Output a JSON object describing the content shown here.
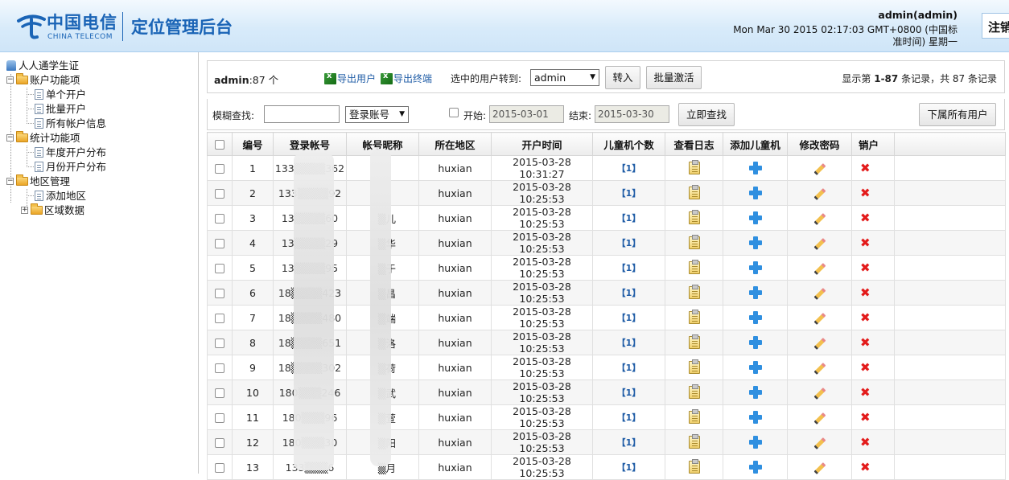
{
  "header": {
    "logo_cn": "中国电信",
    "logo_en": "CHINA TELECOM",
    "app_title": "定位管理后台",
    "user": "admin(admin)",
    "datetime": "Mon Mar 30 2015 02:17:03 GMT+0800 (中国标准时间) 星期一",
    "logout_label": "注销",
    "brand_color": "#1a64b6"
  },
  "sidebar": {
    "root": "人人通学生证",
    "groups": [
      {
        "label": "账户功能项",
        "items": [
          "单个开户",
          "批量开户",
          "所有帐户信息"
        ]
      },
      {
        "label": "统计功能项",
        "items": [
          "年度开户分布",
          "月份开户分布"
        ]
      },
      {
        "label": "地区管理",
        "items": [
          "添加地区",
          "区域数据"
        ]
      }
    ]
  },
  "toolbar": {
    "admin_label": "admin",
    "admin_count": ":87 个",
    "export_users": "导出用户",
    "export_terminals": "导出终端",
    "transfer_label": "选中的用户转到:",
    "transfer_select": "admin",
    "transfer_button": "转入",
    "batch_activate": "批量激活",
    "records_prefix": "显示第 ",
    "records_range": "1-87",
    "records_mid": " 条记录，共 ",
    "records_total": "87",
    "records_suffix": " 条记录"
  },
  "search": {
    "fuzzy_label": "模糊查找:",
    "fuzzy_value": "",
    "field_select": "登录账号",
    "start_label": "开始:",
    "start_date": "2015-03-01",
    "end_label": "结束:",
    "end_date": "2015-03-30",
    "search_button": "立即查找",
    "sub_users_button": "下属所有用户"
  },
  "table": {
    "columns": [
      "编号",
      "登录帐号",
      "帐号昵称",
      "所在地区",
      "开户时间",
      "儿童机个数",
      "查看日志",
      "添加儿童机",
      "修改密码",
      "销户"
    ],
    "rows": [
      {
        "id": "1",
        "account": "133▒▒▒▒362",
        "nick": "",
        "region": "huxian",
        "time": "2015-03-28 10:31:27",
        "count": "【1】"
      },
      {
        "id": "2",
        "account": "133▒▒▒▒92",
        "nick": "",
        "region": "huxian",
        "time": "2015-03-28 10:25:53",
        "count": "【1】"
      },
      {
        "id": "3",
        "account": "13▒▒▒▒60",
        "nick": "▒儿",
        "region": "huxian",
        "time": "2015-03-28 10:25:53",
        "count": "【1】"
      },
      {
        "id": "4",
        "account": "13▒▒▒▒29",
        "nick": "▒华",
        "region": "huxian",
        "time": "2015-03-28 10:25:53",
        "count": "【1】"
      },
      {
        "id": "5",
        "account": "13▒▒▒▒95",
        "nick": "▒于",
        "region": "huxian",
        "time": "2015-03-28 10:25:53",
        "count": "【1】"
      },
      {
        "id": "6",
        "account": "18▒▒▒▒423",
        "nick": "▒昌",
        "region": "huxian",
        "time": "2015-03-28 10:25:53",
        "count": "【1】"
      },
      {
        "id": "7",
        "account": "18▒▒▒▒480",
        "nick": "▒端",
        "region": "huxian",
        "time": "2015-03-28 10:25:53",
        "count": "【1】"
      },
      {
        "id": "8",
        "account": "18▒▒▒▒651",
        "nick": "▒洛",
        "region": "huxian",
        "time": "2015-03-28 10:25:53",
        "count": "【1】"
      },
      {
        "id": "9",
        "account": "18▒▒▒▒302",
        "nick": "▒荷",
        "region": "huxian",
        "time": "2015-03-28 10:25:53",
        "count": "【1】"
      },
      {
        "id": "10",
        "account": "180▒▒▒246",
        "nick": "▒武",
        "region": "huxian",
        "time": "2015-03-28 10:25:53",
        "count": "【1】"
      },
      {
        "id": "11",
        "account": "180▒▒▒96",
        "nick": "▒萱",
        "region": "huxian",
        "time": "2015-03-28 10:25:53",
        "count": "【1】"
      },
      {
        "id": "12",
        "account": "180▒▒▒30",
        "nick": "▒阳",
        "region": "huxian",
        "time": "2015-03-28 10:25:53",
        "count": "【1】"
      },
      {
        "id": "13",
        "account": "133▒▒▒6",
        "nick": "▒月",
        "region": "huxian",
        "time": "2015-03-28 10:25:53",
        "count": "【1】"
      }
    ]
  },
  "icons": {
    "log": "clipboard-icon",
    "add_child": "plus-icon",
    "edit_password": "pencil-icon",
    "delete": "red-x-icon"
  }
}
